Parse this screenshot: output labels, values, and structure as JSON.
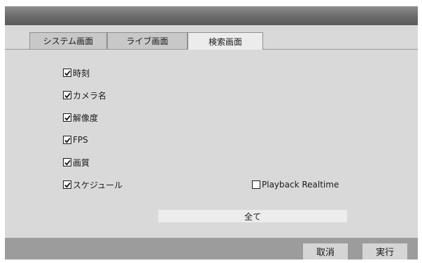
{
  "tabs": [
    {
      "label": "システム画面",
      "active": false
    },
    {
      "label": "ライブ画面",
      "active": false
    },
    {
      "label": "検索画面",
      "active": true
    }
  ],
  "options": [
    {
      "label": "時刻",
      "checked": true
    },
    {
      "label": "カメラ名",
      "checked": true
    },
    {
      "label": "解像度",
      "checked": true
    },
    {
      "label": "FPS",
      "checked": true
    },
    {
      "label": "画質",
      "checked": true
    },
    {
      "label": "スケジュール",
      "checked": true
    },
    {
      "label": "Playback Realtime",
      "checked": false
    }
  ],
  "select_all_label": "全て",
  "buttons": {
    "cancel_label": "取消",
    "execute_label": "実行"
  }
}
